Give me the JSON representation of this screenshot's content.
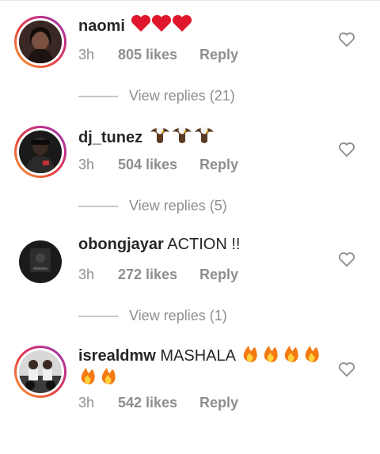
{
  "comments": [
    {
      "username": "naomi",
      "text": "❤️❤️❤️",
      "time": "3h",
      "likes": "805 likes",
      "reply_label": "Reply",
      "view_replies": "View replies (21)",
      "avatar_ring": true
    },
    {
      "username": "dj_tunez",
      "text": "🦅🦅🦅",
      "time": "3h",
      "likes": "504 likes",
      "reply_label": "Reply",
      "view_replies": "View replies (5)",
      "avatar_ring": true
    },
    {
      "username": "obongjayar",
      "text": "ACTION !!",
      "time": "3h",
      "likes": "272 likes",
      "reply_label": "Reply",
      "view_replies": "View replies (1)",
      "avatar_ring": false
    },
    {
      "username": "isrealdmw",
      "text": "MASHALA 🔥🔥🔥🔥🔥🔥",
      "time": "3h",
      "likes": "542 likes",
      "reply_label": "Reply",
      "avatar_ring": true
    }
  ],
  "colors": {
    "text": "#262626",
    "muted": "#8e8e8e",
    "heart_red": "#e0162b",
    "ring_gradient": [
      "#f9a23a",
      "#e9453b",
      "#c8307f",
      "#8a3ab9"
    ]
  }
}
